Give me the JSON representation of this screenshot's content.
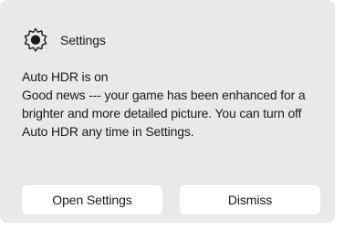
{
  "notification": {
    "app_name": "Settings",
    "app_icon": "settings-gear-icon",
    "title": "Auto HDR is on",
    "message": "Good news --- your game has been enhanced for a brighter and more detailed picture. You can turn off Auto HDR any time in Settings.",
    "message_lines": [
      "Good news --- your game has been enhanced for a",
      "brighter and more detailed picture. You can turn off",
      "Auto HDR any time in Settings."
    ],
    "primary_button_label": "Open Settings",
    "secondary_button_label": "Dismiss"
  },
  "colors": {
    "card_background": "#e9e9e9",
    "button_background": "#ffffff",
    "text": "#1a1a1a"
  }
}
